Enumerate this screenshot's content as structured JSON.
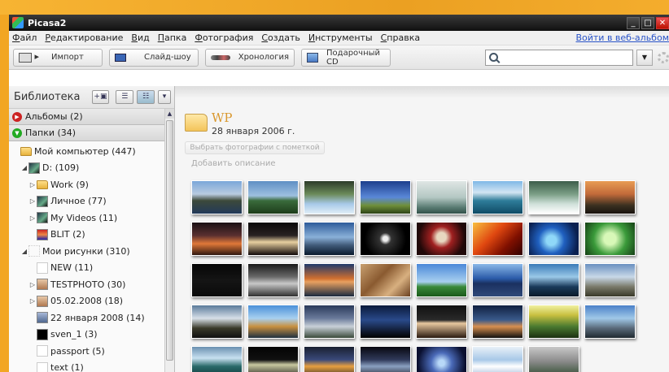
{
  "app": {
    "title": "Picasa2"
  },
  "menu": [
    "Файл",
    "Редактирование",
    "Вид",
    "Папка",
    "Фотография",
    "Создать",
    "Инструменты",
    "Справка"
  ],
  "web_link": "Войти в веб-альбом",
  "toolbar": {
    "import": "Импорт",
    "slideshow": "Слайд-шоу",
    "timeline": "Хронология",
    "gift_cd": "Подарочный CD"
  },
  "search": {
    "value": "",
    "placeholder": ""
  },
  "sidebar": {
    "title": "Библиотека",
    "albums": "Альбомы (2)",
    "folders": "Папки (34)",
    "tree": [
      {
        "label": "Мой компьютер (447)",
        "indent": 0,
        "toggle": "",
        "icon": "folder"
      },
      {
        "label": "D: (109)",
        "indent": 1,
        "toggle": "◢",
        "icon": "dark"
      },
      {
        "label": "Work (9)",
        "indent": 2,
        "toggle": "▷",
        "icon": "folder"
      },
      {
        "label": "Личное (77)",
        "indent": 2,
        "toggle": "▷",
        "icon": "dark"
      },
      {
        "label": "My Videos (11)",
        "indent": 2,
        "toggle": "▷",
        "icon": "dark"
      },
      {
        "label": "BLIT (2)",
        "indent": 2,
        "toggle": "",
        "icon": "blit"
      },
      {
        "label": "Мои рисунки (310)",
        "indent": 1,
        "toggle": "◢",
        "icon": "none"
      },
      {
        "label": "NEW (11)",
        "indent": 2,
        "toggle": "",
        "icon": "white"
      },
      {
        "label": "TESTPHOTO (30)",
        "indent": 2,
        "toggle": "▷",
        "icon": "person"
      },
      {
        "label": "05.02.2008 (18)",
        "indent": 2,
        "toggle": "▷",
        "icon": "person"
      },
      {
        "label": "22 января 2008 (14)",
        "indent": 2,
        "toggle": "",
        "icon": "photo"
      },
      {
        "label": "sven_1 (3)",
        "indent": 2,
        "toggle": "",
        "icon": "black"
      },
      {
        "label": "passport (5)",
        "indent": 2,
        "toggle": "",
        "icon": "doc"
      },
      {
        "label": "text (1)",
        "indent": 2,
        "toggle": "",
        "icon": "doc"
      }
    ]
  },
  "album": {
    "title": "WP",
    "date": "28 января 2006 г.",
    "select_btn": "Выбрать фотографии с пометкой",
    "add_description": "Добавить описание"
  },
  "thumbs": [
    "linear-gradient(#7aa7d9 0%,#b9cbe0 40%,#3d4a3a 60%,#223a5a 100%)",
    "linear-gradient(#5f8fc4 0%,#9ec0e0 45%,#3a6b3c 60%,#1d3d1a 100%)",
    "linear-gradient(#2c3b2a 0%,#6b8a5a 40%,#a7c9e8 70%,#e0eef7 100%)",
    "linear-gradient(#1c3e8c 0%,#5a88d8 50%,#6f8f3a 75%,#2d4418 100%)",
    "linear-gradient(#dfe6e4 0%,#b4c7c3 50%,#5b7d74 80%,#33514a 100%)",
    "linear-gradient(#7fb8e6 0%,#d3e6f3 35%,#2f7d9a 60%,#0f4b66 100%)",
    "linear-gradient(#3c5d4a 0%,#7b9e86 40%,#cfe0d9 70%,#ffffff 100%)",
    "linear-gradient(#e89c54 0%,#c26a3a 40%,#3a3020 75%,#1a1410 100%)",
    "linear-gradient(#1a1014 0%,#5a3030 40%,#e07838 65%,#301810 100%)",
    "linear-gradient(#0a0808 0%,#282222 40%,#e8d0a0 60%,#100808 100%)",
    "linear-gradient(#2d5b9a 0%,#8ab0d8 45%,#405a78 70%,#0a1a2d 100%)",
    "radial-gradient(circle at 50% 50%,#eee 0 8%,#333 20%,#000 70%)",
    "radial-gradient(circle at 50% 45%,#e8d8c0 0 15%,#a02020 35%,#200808 75%)",
    "linear-gradient(135deg,#f8c040 0%,#e04810 40%,#801000 70%,#300000 100%)",
    "radial-gradient(circle at 45% 55%,#8fd8f8 0 15%,#2060c0 40%,#0a2050 80%)",
    "radial-gradient(circle at 50% 50%,#d8f8b8 0 20%,#3a9a3a 55%,#154015 100%)",
    "linear-gradient(#050505 0%,#151515 50%,#0a0a0a 100%)",
    "linear-gradient(#181818 0%,#6a6a6a 40%,#c8c8c8 60%,#303030 100%)",
    "linear-gradient(#203a6a 0%,#d07030 45%,#e8a060 55%,#1a2a40 100%)",
    "linear-gradient(135deg,#c8a070 0%,#8a5a30 40%,#d8b080 70%,#6a4020 100%)",
    "linear-gradient(#4a88d8 0%,#a8d0f0 55%,#3a8a3a 70%,#1a5a1a 100%)",
    "linear-gradient(#8ab8e8 0%,#2a5aa8 45%,#1a3060 60%,#304a7a 100%)",
    "linear-gradient(#3a7ab8 0%,#9ac8e8 40%,#1a3a5a 70%,#0a1a2a 100%)",
    "linear-gradient(#6a90c0 0%,#c8d8e8 40%,#7a7a6a 70%,#3a3a2a 100%)",
    "linear-gradient(#5a7a9a 0%,#d8e0e8 40%,#3a3a2a 70%,#101010 100%)",
    "linear-gradient(#4a90d8 0%,#a8d0f0 40%,#c89040 65%,#203040 100%)",
    "linear-gradient(#2a3a5a 0%,#6a7a9a 40%,#c8d0d8 65%,#3a4a3a 100%)",
    "linear-gradient(#0a1a3a 0%,#2a4a8a 45%,#101a30 80%,#000 100%)",
    "linear-gradient(#101010 0%,#2a2a2a 45%,#e8c8a0 55%,#2a1a10 100%)",
    "linear-gradient(#102040 0%,#3a5a8a 45%,#d89050 65%,#101010 100%)",
    "linear-gradient(#f0f0a0 0%,#c8c040 30%,#4a7a30 65%,#1a3010 100%)",
    "linear-gradient(#4a80c8 0%,#a0c8e8 40%,#5a6a7a 70%,#202a30 100%)",
    "linear-gradient(#6a90b0 0%,#c8e0f0 35%,#2a6a6a 60%,#0a3030 100%)",
    "linear-gradient(#040404 0%,#101010 40%,#c8c8a0 55%,#080808 100%)",
    "linear-gradient(#1a2030 0%,#3a4a7a 40%,#e8a040 60%,#101820 100%)",
    "linear-gradient(#080810 0%,#303a5a 40%,#8aa0c0 60%,#0a0a10 100%)",
    "radial-gradient(circle at 50% 50%,#b8d8f8 0 10%,#4a6ab8 35%,#0a1030 80%)",
    "linear-gradient(#e8f0f8 0%,#a8c8e8 40%,#ffffff 60%,#88a8d0 100%)",
    "linear-gradient(#c8c8c8 0%,#8a8a8a 45%,#5a6a5a 70%,#303830 100%)"
  ]
}
